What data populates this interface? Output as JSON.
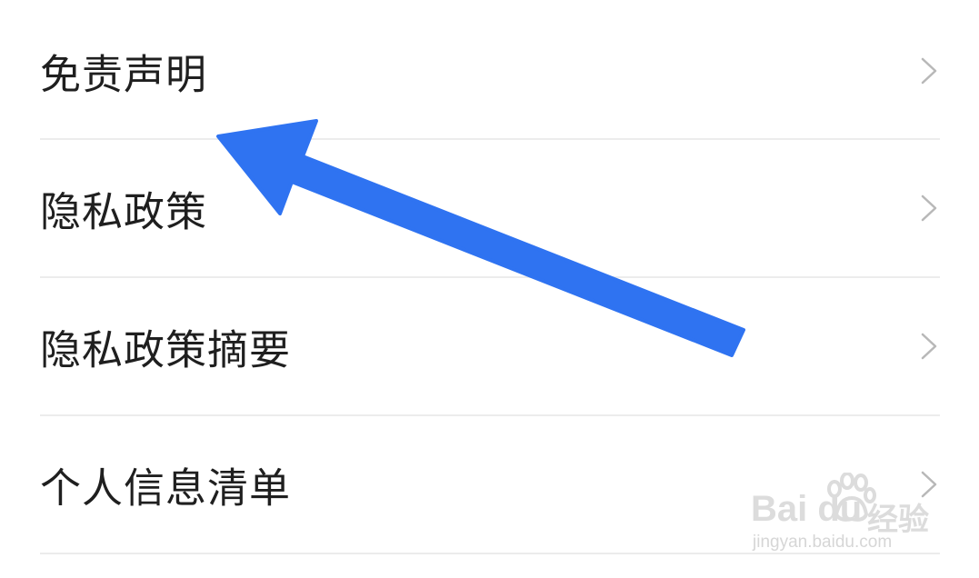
{
  "menu": {
    "items": [
      {
        "label": "免责声明"
      },
      {
        "label": "隐私政策"
      },
      {
        "label": "隐私政策摘要"
      },
      {
        "label": "个人信息清单"
      }
    ]
  },
  "icons": {
    "item_chevron": "chevron-right-icon",
    "annotation": "arrow-annotation"
  },
  "colors": {
    "text": "#1f1f1f",
    "chevron": "#b8b8b8",
    "divider": "#ececec",
    "annotation_arrow": "#2f73f1"
  },
  "watermark": {
    "brand": "Bai du",
    "brand_cn": "经验",
    "url": "jingyan.baidu.com"
  }
}
